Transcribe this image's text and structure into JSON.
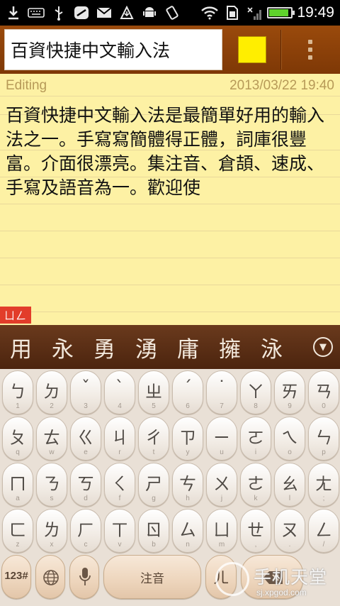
{
  "status_bar": {
    "time": "19:49",
    "battery_level": 0.85,
    "icons": [
      "download-icon",
      "keyboard-icon",
      "usb-icon",
      "app-icon",
      "mail-icon",
      "signal-arrow-icon",
      "android-icon",
      "rotate-icon",
      "wifi-icon",
      "sim-icon",
      "mobile-signal-icon",
      "battery-icon"
    ]
  },
  "title_bar": {
    "title": "百資快捷中文輸入法",
    "note_color": "#ffee00",
    "menu_icon": "overflow-menu-icon"
  },
  "note": {
    "status": "Editing",
    "timestamp": "2013/03/22 19:40",
    "body": "百資快捷中文輸入法是最簡單好用的輸入法之一。手寫寫簡體得正體，詞庫很豐富。介面很漂亮。集注音、倉頡、速成、手寫及語音為一。歡迎使",
    "compose_badge": "ㄩㄥ"
  },
  "candidates": {
    "items": [
      "用",
      "永",
      "勇",
      "湧",
      "庸",
      "擁",
      "泳"
    ],
    "expand_icon": "chevron-down-circle-icon"
  },
  "keyboard": {
    "rows": [
      [
        {
          "main": "ㄅ",
          "sub": "1"
        },
        {
          "main": "ㄉ",
          "sub": "2"
        },
        {
          "main": "ˇ",
          "sub": "3"
        },
        {
          "main": "ˋ",
          "sub": "4"
        },
        {
          "main": "ㄓ",
          "sub": "5"
        },
        {
          "main": "ˊ",
          "sub": "6"
        },
        {
          "main": "˙",
          "sub": "7"
        },
        {
          "main": "ㄚ",
          "sub": "8"
        },
        {
          "main": "ㄞ",
          "sub": "9"
        },
        {
          "main": "ㄢ",
          "sub": "0"
        }
      ],
      [
        {
          "main": "ㄆ",
          "sub": "q"
        },
        {
          "main": "ㄊ",
          "sub": "w"
        },
        {
          "main": "ㄍ",
          "sub": "e"
        },
        {
          "main": "ㄐ",
          "sub": "r"
        },
        {
          "main": "ㄔ",
          "sub": "t"
        },
        {
          "main": "ㄗ",
          "sub": "y"
        },
        {
          "main": "ㄧ",
          "sub": "u"
        },
        {
          "main": "ㄛ",
          "sub": "i"
        },
        {
          "main": "ㄟ",
          "sub": "o"
        },
        {
          "main": "ㄣ",
          "sub": "p"
        }
      ],
      [
        {
          "main": "ㄇ",
          "sub": "a"
        },
        {
          "main": "ㄋ",
          "sub": "s"
        },
        {
          "main": "ㄎ",
          "sub": "d"
        },
        {
          "main": "ㄑ",
          "sub": "f"
        },
        {
          "main": "ㄕ",
          "sub": "g"
        },
        {
          "main": "ㄘ",
          "sub": "h"
        },
        {
          "main": "ㄨ",
          "sub": "j"
        },
        {
          "main": "ㄜ",
          "sub": "k"
        },
        {
          "main": "ㄠ",
          "sub": "l"
        },
        {
          "main": "ㄤ",
          "sub": ";"
        }
      ],
      [
        {
          "main": "ㄈ",
          "sub": "z"
        },
        {
          "main": "ㄌ",
          "sub": "x"
        },
        {
          "main": "ㄏ",
          "sub": "c"
        },
        {
          "main": "ㄒ",
          "sub": "v"
        },
        {
          "main": "ㄖ",
          "sub": "b"
        },
        {
          "main": "ㄙ",
          "sub": "n"
        },
        {
          "main": "ㄩ",
          "sub": "m"
        },
        {
          "main": "ㄝ",
          "sub": ","
        },
        {
          "main": "ㄡ",
          "sub": "."
        },
        {
          "main": "ㄥ",
          "sub": "/"
        }
      ]
    ],
    "bottom": {
      "symbols_label": "123#",
      "globe_icon": "globe-icon",
      "mic_icon": "microphone-icon",
      "space_label": "注音",
      "extra_label": "ㄦ",
      "delete_icon": "backspace-icon"
    }
  },
  "watermark": {
    "brand": "手机天堂",
    "url": "sj.xpgod.com"
  }
}
